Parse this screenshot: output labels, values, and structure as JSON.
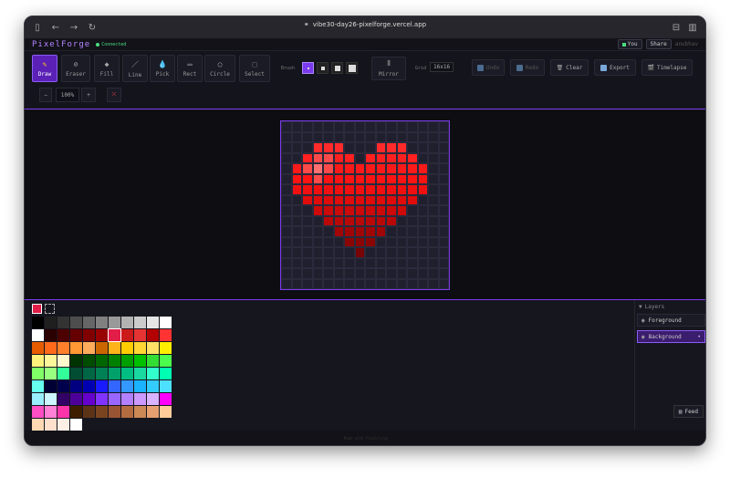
{
  "browser": {
    "url": "vibe30-day26-pixelforge.vercel.app"
  },
  "app": {
    "title": "PixelForge",
    "status": "Connected",
    "user_chip": "You",
    "share": "Share",
    "username": "anubhav"
  },
  "tools": [
    {
      "label": "Draw",
      "icon": "pencil-icon",
      "active": true
    },
    {
      "label": "Eraser",
      "icon": "eraser-icon"
    },
    {
      "label": "Fill",
      "icon": "fill-icon"
    },
    {
      "label": "Line",
      "icon": "line-icon"
    },
    {
      "label": "Pick",
      "icon": "eyedropper-icon"
    },
    {
      "label": "Rect",
      "icon": "rect-icon"
    },
    {
      "label": "Circle",
      "icon": "circle-icon"
    },
    {
      "label": "Select",
      "icon": "select-icon"
    }
  ],
  "brush": {
    "label": "Brush"
  },
  "mirror": {
    "label": "Mirror"
  },
  "grid": {
    "label": "Grid",
    "value": "16x16"
  },
  "actions": {
    "undo": "Undo",
    "redo": "Redo",
    "clear": "Clear",
    "export": "Export",
    "timelapse": "Timelapse"
  },
  "zoom": {
    "minus": "−",
    "value": "100%",
    "plus": "+"
  },
  "colors": {
    "accent": "#7c3aed",
    "current": "#e11d48"
  },
  "canvas": {
    "size": 16,
    "pixels": [
      {
        "r": 2,
        "c": 3,
        "col": "#ff2a2a"
      },
      {
        "r": 2,
        "c": 4,
        "col": "#ff2a2a"
      },
      {
        "r": 2,
        "c": 5,
        "col": "#ff2a2a"
      },
      {
        "r": 2,
        "c": 9,
        "col": "#ff2a2a"
      },
      {
        "r": 2,
        "c": 10,
        "col": "#ff2a2a"
      },
      {
        "r": 2,
        "c": 11,
        "col": "#ff2a2a"
      },
      {
        "r": 3,
        "c": 2,
        "col": "#ff2020"
      },
      {
        "r": 3,
        "c": 3,
        "col": "#ff4a4a"
      },
      {
        "r": 3,
        "c": 4,
        "col": "#ff4a4a"
      },
      {
        "r": 3,
        "c": 5,
        "col": "#ff2020"
      },
      {
        "r": 3,
        "c": 6,
        "col": "#ff2020"
      },
      {
        "r": 3,
        "c": 8,
        "col": "#ff2020"
      },
      {
        "r": 3,
        "c": 9,
        "col": "#ff2020"
      },
      {
        "r": 3,
        "c": 10,
        "col": "#ff2020"
      },
      {
        "r": 3,
        "c": 11,
        "col": "#ff2020"
      },
      {
        "r": 3,
        "c": 12,
        "col": "#ff2020"
      },
      {
        "r": 4,
        "c": 1,
        "col": "#ff1a1a"
      },
      {
        "r": 4,
        "c": 2,
        "col": "#ff4a4a"
      },
      {
        "r": 4,
        "c": 3,
        "col": "#ff7070"
      },
      {
        "r": 4,
        "c": 4,
        "col": "#ff4a4a"
      },
      {
        "r": 4,
        "c": 5,
        "col": "#ff1a1a"
      },
      {
        "r": 4,
        "c": 6,
        "col": "#ff1a1a"
      },
      {
        "r": 4,
        "c": 7,
        "col": "#ff1a1a"
      },
      {
        "r": 4,
        "c": 8,
        "col": "#ff1a1a"
      },
      {
        "r": 4,
        "c": 9,
        "col": "#ff1a1a"
      },
      {
        "r": 4,
        "c": 10,
        "col": "#ff1a1a"
      },
      {
        "r": 4,
        "c": 11,
        "col": "#ff1a1a"
      },
      {
        "r": 4,
        "c": 12,
        "col": "#ff1a1a"
      },
      {
        "r": 4,
        "c": 13,
        "col": "#ff1a1a"
      },
      {
        "r": 5,
        "c": 1,
        "col": "#ff1414"
      },
      {
        "r": 5,
        "c": 2,
        "col": "#ff1414"
      },
      {
        "r": 5,
        "c": 3,
        "col": "#ff4a4a"
      },
      {
        "r": 5,
        "c": 4,
        "col": "#ff1414"
      },
      {
        "r": 5,
        "c": 5,
        "col": "#ff1414"
      },
      {
        "r": 5,
        "c": 6,
        "col": "#ff1414"
      },
      {
        "r": 5,
        "c": 7,
        "col": "#ff1414"
      },
      {
        "r": 5,
        "c": 8,
        "col": "#ff1414"
      },
      {
        "r": 5,
        "c": 9,
        "col": "#ff1414"
      },
      {
        "r": 5,
        "c": 10,
        "col": "#ff1414"
      },
      {
        "r": 5,
        "c": 11,
        "col": "#ff1414"
      },
      {
        "r": 5,
        "c": 12,
        "col": "#ff1414"
      },
      {
        "r": 5,
        "c": 13,
        "col": "#ff1414"
      },
      {
        "r": 6,
        "c": 1,
        "col": "#f01010"
      },
      {
        "r": 6,
        "c": 2,
        "col": "#f01010"
      },
      {
        "r": 6,
        "c": 3,
        "col": "#f01010"
      },
      {
        "r": 6,
        "c": 4,
        "col": "#f01010"
      },
      {
        "r": 6,
        "c": 5,
        "col": "#f01010"
      },
      {
        "r": 6,
        "c": 6,
        "col": "#f01010"
      },
      {
        "r": 6,
        "c": 7,
        "col": "#f01010"
      },
      {
        "r": 6,
        "c": 8,
        "col": "#f01010"
      },
      {
        "r": 6,
        "c": 9,
        "col": "#f01010"
      },
      {
        "r": 6,
        "c": 10,
        "col": "#f01010"
      },
      {
        "r": 6,
        "c": 11,
        "col": "#f01010"
      },
      {
        "r": 6,
        "c": 12,
        "col": "#f01010"
      },
      {
        "r": 6,
        "c": 13,
        "col": "#f01010"
      },
      {
        "r": 7,
        "c": 2,
        "col": "#e00c0c"
      },
      {
        "r": 7,
        "c": 3,
        "col": "#e00c0c"
      },
      {
        "r": 7,
        "c": 4,
        "col": "#e00c0c"
      },
      {
        "r": 7,
        "c": 5,
        "col": "#e00c0c"
      },
      {
        "r": 7,
        "c": 6,
        "col": "#e00c0c"
      },
      {
        "r": 7,
        "c": 7,
        "col": "#e00c0c"
      },
      {
        "r": 7,
        "c": 8,
        "col": "#e00c0c"
      },
      {
        "r": 7,
        "c": 9,
        "col": "#e00c0c"
      },
      {
        "r": 7,
        "c": 10,
        "col": "#e00c0c"
      },
      {
        "r": 7,
        "c": 11,
        "col": "#e00c0c"
      },
      {
        "r": 7,
        "c": 12,
        "col": "#e00c0c"
      },
      {
        "r": 8,
        "c": 3,
        "col": "#cc0a0a"
      },
      {
        "r": 8,
        "c": 4,
        "col": "#cc0a0a"
      },
      {
        "r": 8,
        "c": 5,
        "col": "#cc0a0a"
      },
      {
        "r": 8,
        "c": 6,
        "col": "#cc0a0a"
      },
      {
        "r": 8,
        "c": 7,
        "col": "#cc0a0a"
      },
      {
        "r": 8,
        "c": 8,
        "col": "#cc0a0a"
      },
      {
        "r": 8,
        "c": 9,
        "col": "#cc0a0a"
      },
      {
        "r": 8,
        "c": 10,
        "col": "#cc0a0a"
      },
      {
        "r": 8,
        "c": 11,
        "col": "#cc0a0a"
      },
      {
        "r": 9,
        "c": 4,
        "col": "#b80808"
      },
      {
        "r": 9,
        "c": 5,
        "col": "#b80808"
      },
      {
        "r": 9,
        "c": 6,
        "col": "#b80808"
      },
      {
        "r": 9,
        "c": 7,
        "col": "#b80808"
      },
      {
        "r": 9,
        "c": 8,
        "col": "#b80808"
      },
      {
        "r": 9,
        "c": 9,
        "col": "#b80808"
      },
      {
        "r": 9,
        "c": 10,
        "col": "#b80808"
      },
      {
        "r": 10,
        "c": 5,
        "col": "#a00606"
      },
      {
        "r": 10,
        "c": 6,
        "col": "#a00606"
      },
      {
        "r": 10,
        "c": 7,
        "col": "#a00606"
      },
      {
        "r": 10,
        "c": 8,
        "col": "#a00606"
      },
      {
        "r": 10,
        "c": 9,
        "col": "#a00606"
      },
      {
        "r": 11,
        "c": 6,
        "col": "#8c0505"
      },
      {
        "r": 11,
        "c": 7,
        "col": "#8c0505"
      },
      {
        "r": 11,
        "c": 8,
        "col": "#8c0505"
      },
      {
        "r": 12,
        "c": 7,
        "col": "#780404"
      }
    ]
  },
  "palette": [
    "#000000",
    "#1f1f1f",
    "#333333",
    "#4d4d4d",
    "#666666",
    "#808080",
    "#999999",
    "#b3b3b3",
    "#cccccc",
    "#e6e6e6",
    "#ffffff",
    "#ffffff",
    "#2a0000",
    "#4d0000",
    "#660000",
    "#800000",
    "#990000",
    "#e11d48",
    "#cc1a1a",
    "#e63333",
    "#b30000",
    "#ff3333",
    "#e65c00",
    "#ff6a1a",
    "#ff7f2a",
    "#ff9933",
    "#ffad5c",
    "#cc6600",
    "#ffb31a",
    "#ffcc00",
    "#ffd633",
    "#ffe066",
    "#ffee00",
    "#fff27a",
    "#fff599",
    "#fff8cc",
    "#003300",
    "#004d00",
    "#006600",
    "#008000",
    "#00a000",
    "#00c000",
    "#33dd33",
    "#4dff4d",
    "#80ff66",
    "#99ff80",
    "#33ff99",
    "#004d33",
    "#006644",
    "#008055",
    "#00a06a",
    "#00bf80",
    "#1ad9a0",
    "#33ffcc",
    "#00ffb3",
    "#66ffee",
    "#000033",
    "#00004d",
    "#000080",
    "#0000b3",
    "#1a1aff",
    "#3366ff",
    "#3399ff",
    "#1ab3ff",
    "#33ccff",
    "#4de0ff",
    "#99eeff",
    "#ccf7ff",
    "#330066",
    "#4d0099",
    "#6600cc",
    "#8033ff",
    "#9966ff",
    "#b380ff",
    "#cc99ff",
    "#d9b3ff",
    "#ff00ff",
    "#ff4dc4",
    "#ff80d4",
    "#ff33aa",
    "#3d1f00",
    "#5c3317",
    "#7a4420",
    "#995533",
    "#b36b40",
    "#cc8855",
    "#e6a070",
    "#ffcc99",
    "#ffd9b3",
    "#ffe0cc",
    "#fff0e6",
    "#ffffff"
  ],
  "layers": {
    "title": "Layers",
    "items": [
      {
        "name": "Foreground"
      },
      {
        "name": "Background",
        "active": true
      }
    ]
  },
  "feed": "Feed",
  "footer": "Made with PixelForge"
}
